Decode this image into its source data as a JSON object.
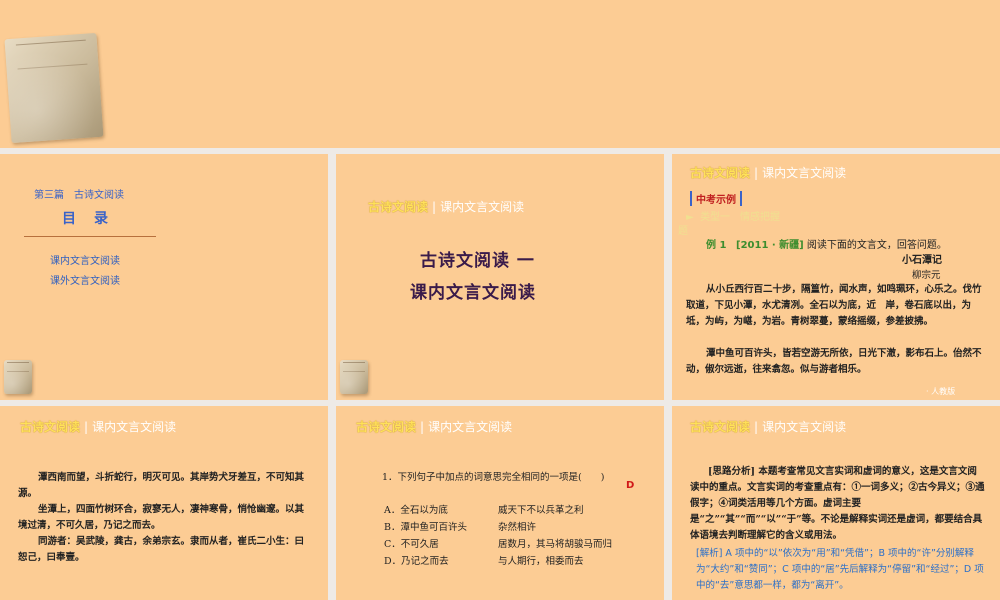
{
  "hdr": {
    "a": "古诗文阅读",
    "sep": "|",
    "b": "课内文言文阅读"
  },
  "s1": {
    "section": "第三篇　古诗文阅读",
    "toc": "目　录",
    "link1": "课内文言文阅读",
    "link2": "课外文言文阅读"
  },
  "s2": {
    "line1": "古诗文阅读 一",
    "line2": "课内文言文阅读"
  },
  "s3": {
    "badge": "中考示例",
    "type": "类型一　情感把握",
    "type2": "题",
    "ex_label": "例 1",
    "ex_src": "[2011 · 新疆]",
    "ex_text": "阅读下面的文言文，回答问题。",
    "title": "小石潭记",
    "author": "柳宗元",
    "p1": "从小丘西行百二十步，隔篁竹，闻水声，如鸣珮环，心乐之。伐竹取道，下见小潭，水尤清冽。全石以为底，近　岸，卷石底以出，为坻，为屿，为嵁，为岩。青树翠蔓，蒙络摇缀，参差披拂。",
    "p2": "潭中鱼可百许头，皆若空游无所依，日光下澈，影布石上。佁然不动，俶尔远逝，往来翕忽。似与游者相乐。",
    "footer": "· 人教版"
  },
  "s4": {
    "p1": "潭西南而望，斗折蛇行，明灭可见。其岸势犬牙差互，不可知其源。",
    "p2": "坐潭上，四面竹树环合，寂寥无人，凄神寒骨，悄怆幽邃。以其境过清，不可久居，乃记之而去。",
    "p3": "同游者：吴武陵，龚古，余弟宗玄。隶而从者，崔氏二小生：曰恕己，曰奉壹。"
  },
  "s5": {
    "q": "1．下列句子中加点的词意思完全相同的一项是(　　)",
    "answer": "D",
    "options": [
      {
        "l": "A．全石以为底",
        "r": "威天下不以兵革之利"
      },
      {
        "l": "B．潭中鱼可百许头",
        "r": "杂然相许"
      },
      {
        "l": "C．不可久居",
        "r": "居数月，其马将胡骏马而归"
      },
      {
        "l": "D．乃记之而去",
        "r": "与人期行，相委而去"
      }
    ]
  },
  "s6": {
    "p1_label": "[思路分析]",
    "p1": "本题考查常见文言实词和虚词的意义，这是文言文阅读中的重点。文言实词的考查重点有：①一词多义；②古今异义；③通假字；④词类活用等几个方面。虚词主要是“之”“其”“而”“以”“于”等。不论是解释实词还是虚词，都要结合具体语境去判断理解它的含义或用法。",
    "p2": "[解析] A 项中的“以”依次为“用”和“凭借”；B 项中的“许”分别解释为“大约”和“赞同”；C 项中的“居”先后解释为“停留”和“经过”；D 项中的“去”意思都一样，都为“离开”。"
  }
}
